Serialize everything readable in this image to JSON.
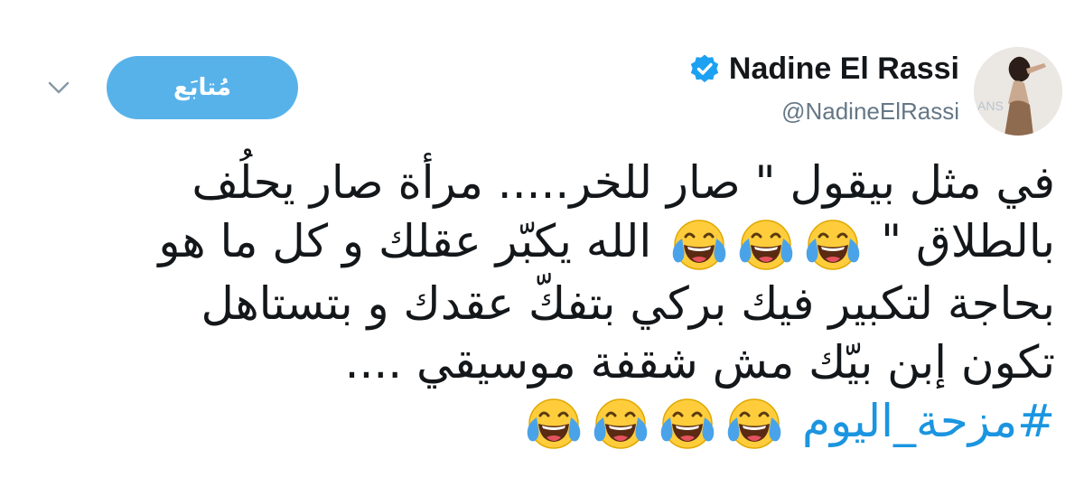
{
  "header": {
    "display_name": "Nadine El Rassi",
    "handle": "@NadineElRassi",
    "follow_label": "مُتابَع",
    "verified": true,
    "icons": [
      "chevron-down-icon",
      "verified-badge-icon"
    ]
  },
  "tweet": {
    "lines": [
      "في مثل بيقول \" صار للخر..... مرأة صار يحلُف",
      "بالطلاق \"",
      "الله يكبّر عقلك و كل ما هو",
      "بحاجة لتكبير فيك بركي بتفكّ عقدك و بتستاهل",
      "تكون إبن بيّك مش شقفة موسيقي ...."
    ],
    "hashtag": "#مزحة_اليوم",
    "emoji_name": "face-with-tears-of-joy",
    "emoji_counts": {
      "line2": 3,
      "hashtag_line": 4
    }
  },
  "colors": {
    "accent": "#1b95e0",
    "follow_button": "#58b2ea",
    "text": "#14171a",
    "secondary_text": "#657786",
    "emoji_face": "#ffcd3c",
    "emoji_tears": "#4aa3e8"
  }
}
